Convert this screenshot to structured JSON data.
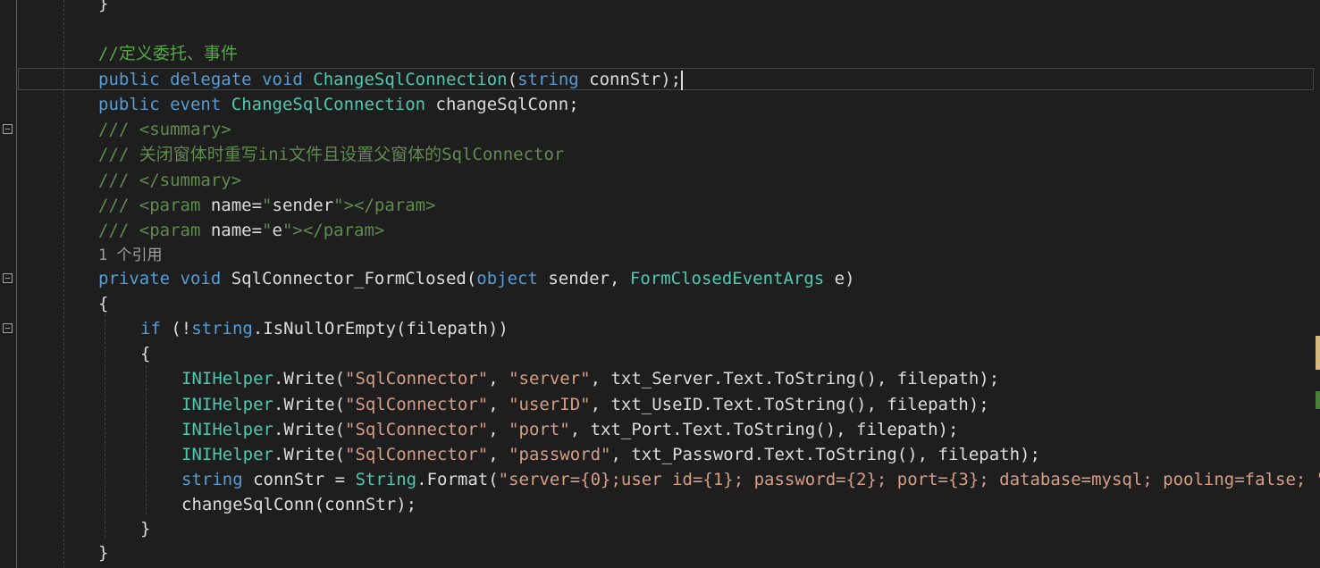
{
  "code": {
    "lines": [
      {
        "tokens": [
          {
            "c": "pl",
            "t": "}"
          }
        ]
      },
      {
        "tokens": [
          {
            "c": "cm",
            "t": "//定义委托、事件"
          }
        ]
      },
      {
        "tokens": [
          {
            "c": "kw",
            "t": "public"
          },
          {
            "c": "pl",
            "t": " "
          },
          {
            "c": "kw",
            "t": "delegate"
          },
          {
            "c": "pl",
            "t": " "
          },
          {
            "c": "kw",
            "t": "void"
          },
          {
            "c": "pl",
            "t": " "
          },
          {
            "c": "ty",
            "t": "ChangeSqlConnection"
          },
          {
            "c": "pl",
            "t": "("
          },
          {
            "c": "kw",
            "t": "string"
          },
          {
            "c": "pl",
            "t": " connStr);"
          }
        ]
      },
      {
        "tokens": [
          {
            "c": "kw",
            "t": "public"
          },
          {
            "c": "pl",
            "t": " "
          },
          {
            "c": "kw",
            "t": "event"
          },
          {
            "c": "pl",
            "t": " "
          },
          {
            "c": "ty",
            "t": "ChangeSqlConnection"
          },
          {
            "c": "pl",
            "t": " changeSqlConn;"
          }
        ]
      },
      {
        "tokens": [
          {
            "c": "xd",
            "t": "/// "
          },
          {
            "c": "tag",
            "t": "<summary>"
          }
        ]
      },
      {
        "tokens": [
          {
            "c": "xd",
            "t": "/// 关闭窗体时重写ini文件且设置父窗体的SqlConnector"
          }
        ]
      },
      {
        "tokens": [
          {
            "c": "xd",
            "t": "/// "
          },
          {
            "c": "tag",
            "t": "</summary>"
          }
        ]
      },
      {
        "tokens": [
          {
            "c": "xd",
            "t": "/// "
          },
          {
            "c": "tag",
            "t": "<param"
          },
          {
            "c": "pl",
            "t": " name="
          },
          {
            "c": "tag",
            "t": "\""
          },
          {
            "c": "pl",
            "t": "sender"
          },
          {
            "c": "tag",
            "t": "\"></param>"
          }
        ]
      },
      {
        "tokens": [
          {
            "c": "xd",
            "t": "/// "
          },
          {
            "c": "tag",
            "t": "<param"
          },
          {
            "c": "pl",
            "t": " name="
          },
          {
            "c": "tag",
            "t": "\""
          },
          {
            "c": "pl",
            "t": "e"
          },
          {
            "c": "tag",
            "t": "\"></param>"
          }
        ]
      },
      {
        "tokens": [
          {
            "c": "ref",
            "t": "1 个引用"
          }
        ]
      },
      {
        "tokens": [
          {
            "c": "kw",
            "t": "private"
          },
          {
            "c": "pl",
            "t": " "
          },
          {
            "c": "kw",
            "t": "void"
          },
          {
            "c": "pl",
            "t": " SqlConnector_FormClosed("
          },
          {
            "c": "kw",
            "t": "object"
          },
          {
            "c": "pl",
            "t": " sender, "
          },
          {
            "c": "ty",
            "t": "FormClosedEventArgs"
          },
          {
            "c": "pl",
            "t": " e)"
          }
        ]
      },
      {
        "tokens": [
          {
            "c": "pl",
            "t": "{"
          }
        ]
      },
      {
        "tokens": [
          {
            "c": "kw",
            "t": "if"
          },
          {
            "c": "pl",
            "t": " (!"
          },
          {
            "c": "kw",
            "t": "string"
          },
          {
            "c": "pl",
            "t": ".IsNullOrEmpty(filepath))"
          }
        ]
      },
      {
        "tokens": [
          {
            "c": "pl",
            "t": "{"
          }
        ]
      },
      {
        "tokens": [
          {
            "c": "ty",
            "t": "INIHelper"
          },
          {
            "c": "pl",
            "t": ".Write("
          },
          {
            "c": "st",
            "t": "\"SqlConnector\""
          },
          {
            "c": "pl",
            "t": ", "
          },
          {
            "c": "st",
            "t": "\"server\""
          },
          {
            "c": "pl",
            "t": ", txt_Server.Text.ToString(), filepath);"
          }
        ]
      },
      {
        "tokens": [
          {
            "c": "ty",
            "t": "INIHelper"
          },
          {
            "c": "pl",
            "t": ".Write("
          },
          {
            "c": "st",
            "t": "\"SqlConnector\""
          },
          {
            "c": "pl",
            "t": ", "
          },
          {
            "c": "st",
            "t": "\"userID\""
          },
          {
            "c": "pl",
            "t": ", txt_UseID.Text.ToString(), filepath);"
          }
        ]
      },
      {
        "tokens": [
          {
            "c": "ty",
            "t": "INIHelper"
          },
          {
            "c": "pl",
            "t": ".Write("
          },
          {
            "c": "st",
            "t": "\"SqlConnector\""
          },
          {
            "c": "pl",
            "t": ", "
          },
          {
            "c": "st",
            "t": "\"port\""
          },
          {
            "c": "pl",
            "t": ", txt_Port.Text.ToString(), filepath);"
          }
        ]
      },
      {
        "tokens": [
          {
            "c": "ty",
            "t": "INIHelper"
          },
          {
            "c": "pl",
            "t": ".Write("
          },
          {
            "c": "st",
            "t": "\"SqlConnector\""
          },
          {
            "c": "pl",
            "t": ", "
          },
          {
            "c": "st",
            "t": "\"password\""
          },
          {
            "c": "pl",
            "t": ", txt_Password.Text.ToString(), filepath);"
          }
        ]
      },
      {
        "tokens": [
          {
            "c": "kw",
            "t": "string"
          },
          {
            "c": "pl",
            "t": " connStr = "
          },
          {
            "c": "ty",
            "t": "String"
          },
          {
            "c": "pl",
            "t": ".Format("
          },
          {
            "c": "st",
            "t": "\"server={0};user id={1}; password={2}; port={3}; database=mysql; pooling=false; \""
          }
        ]
      },
      {
        "tokens": [
          {
            "c": "pl",
            "t": "changeSqlConn(connStr);"
          }
        ]
      },
      {
        "tokens": [
          {
            "c": "pl",
            "t": "}"
          }
        ]
      },
      {
        "tokens": [
          {
            "c": "pl",
            "t": "}"
          }
        ]
      }
    ]
  }
}
